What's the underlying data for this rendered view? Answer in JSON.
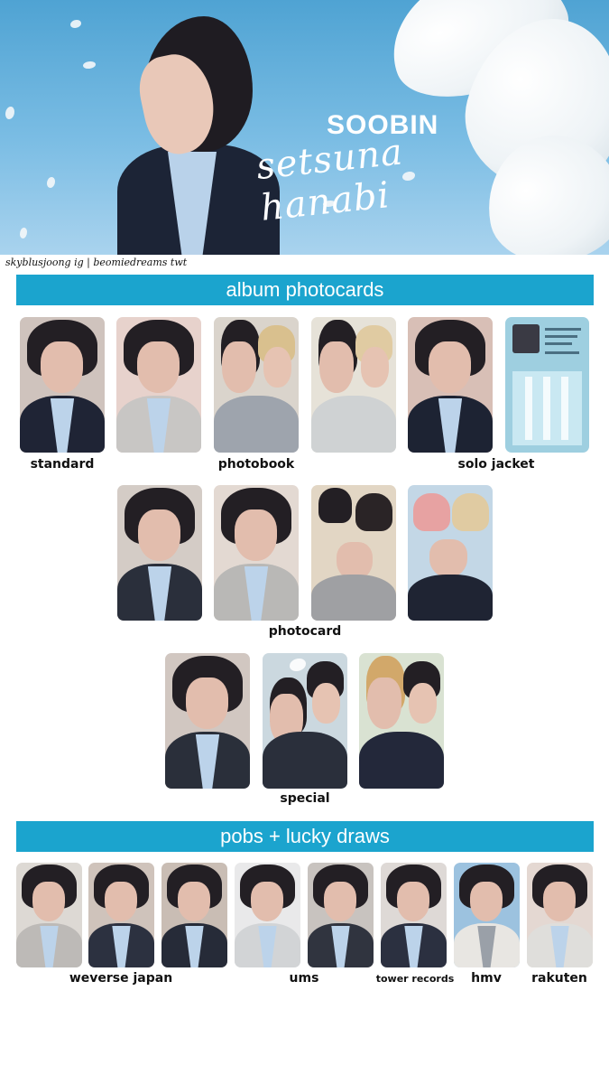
{
  "header": {
    "artist": "SOOBIN",
    "title": "setsuna hanabi",
    "credit": "skyblusjoong ig | beomiedreams twt"
  },
  "sections": {
    "album": {
      "title": "album photocards",
      "labels": {
        "standard": "standard",
        "photobook": "photobook",
        "solo_jacket": "solo jacket",
        "photocard": "photocard",
        "special": "special"
      }
    },
    "pobs": {
      "title": "pobs + lucky draws",
      "labels": {
        "weverse_japan": "weverse japan",
        "ums": "ums",
        "tower_records": "tower records",
        "hmv": "hmv",
        "rakuten": "rakuten"
      }
    }
  },
  "colors": {
    "section_bar": "#1ba4ce",
    "banner_sky": "#6fb4de"
  }
}
